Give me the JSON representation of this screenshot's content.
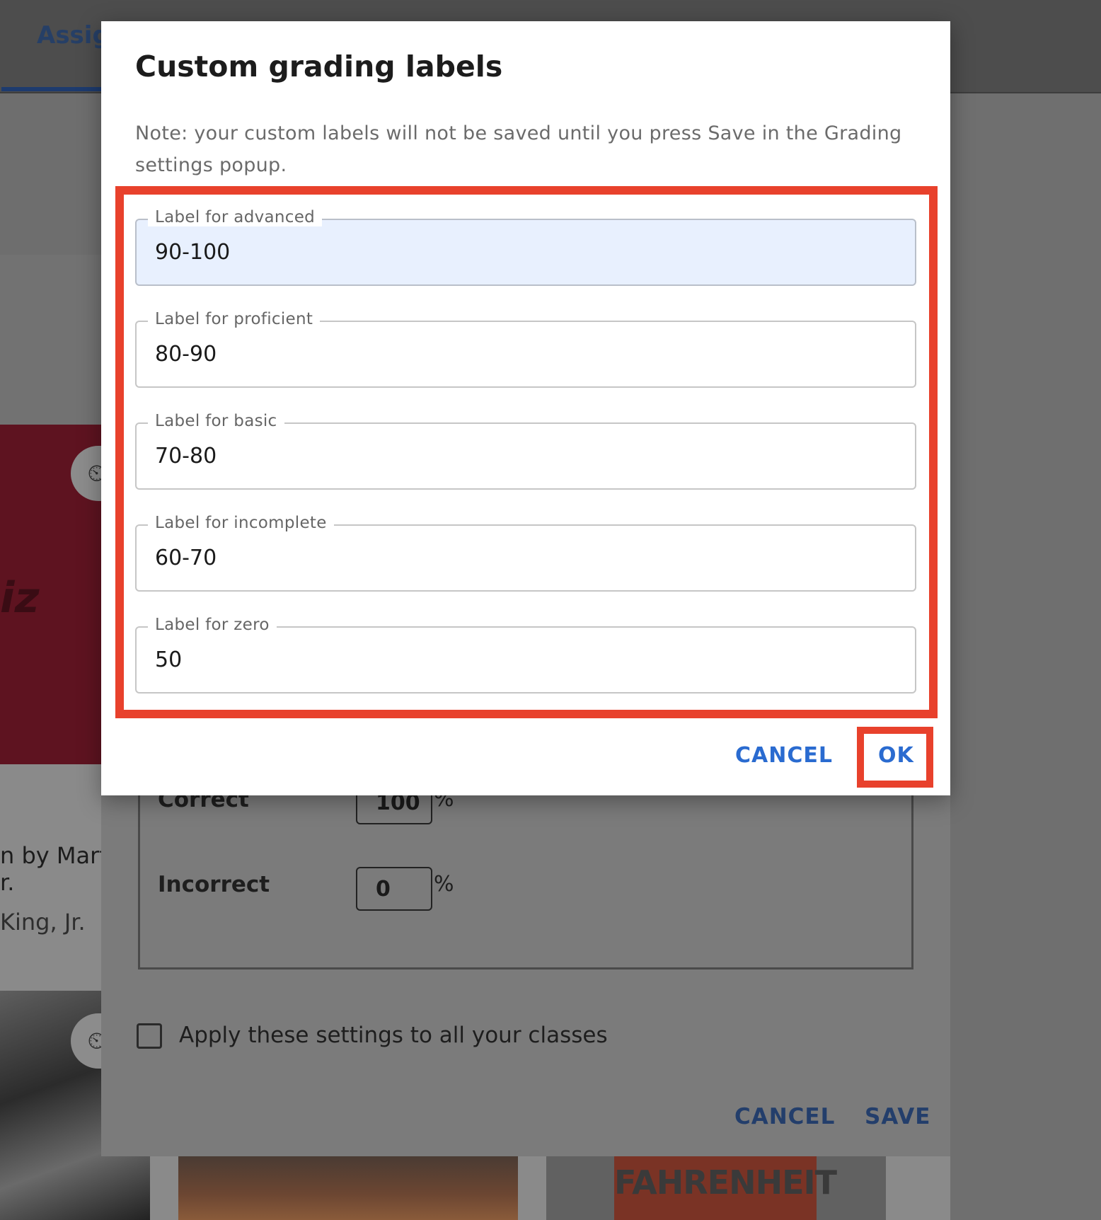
{
  "background": {
    "tab_label": "Assig",
    "card_quiz_text": "iz",
    "card_title_line1": "n by Marti",
    "card_title_line2": "r.",
    "card_author": "King, Jr.",
    "book_title": "FAHRENHEIT"
  },
  "grading_settings": {
    "rows": [
      {
        "label": "Correct",
        "value": "100",
        "unit": "%"
      },
      {
        "label": "Incorrect",
        "value": "0",
        "unit": "%"
      }
    ],
    "apply_all_label": "Apply these settings to all your classes",
    "cancel_label": "CANCEL",
    "save_label": "SAVE"
  },
  "modal": {
    "title": "Custom grading labels",
    "note": "Note: your custom labels will not be saved until you press Save in the Grading settings popup.",
    "fields": [
      {
        "label": "Label for advanced",
        "value": "90-100"
      },
      {
        "label": "Label for proficient",
        "value": "80-90"
      },
      {
        "label": "Label for basic",
        "value": "70-80"
      },
      {
        "label": "Label for incomplete",
        "value": "60-70"
      },
      {
        "label": "Label for zero",
        "value": "50"
      }
    ],
    "cancel_label": "CANCEL",
    "ok_label": "OK"
  },
  "colors": {
    "accent": "#2a6bd0",
    "highlight": "#e8412c",
    "autofill_bg": "#e8f0fe"
  }
}
